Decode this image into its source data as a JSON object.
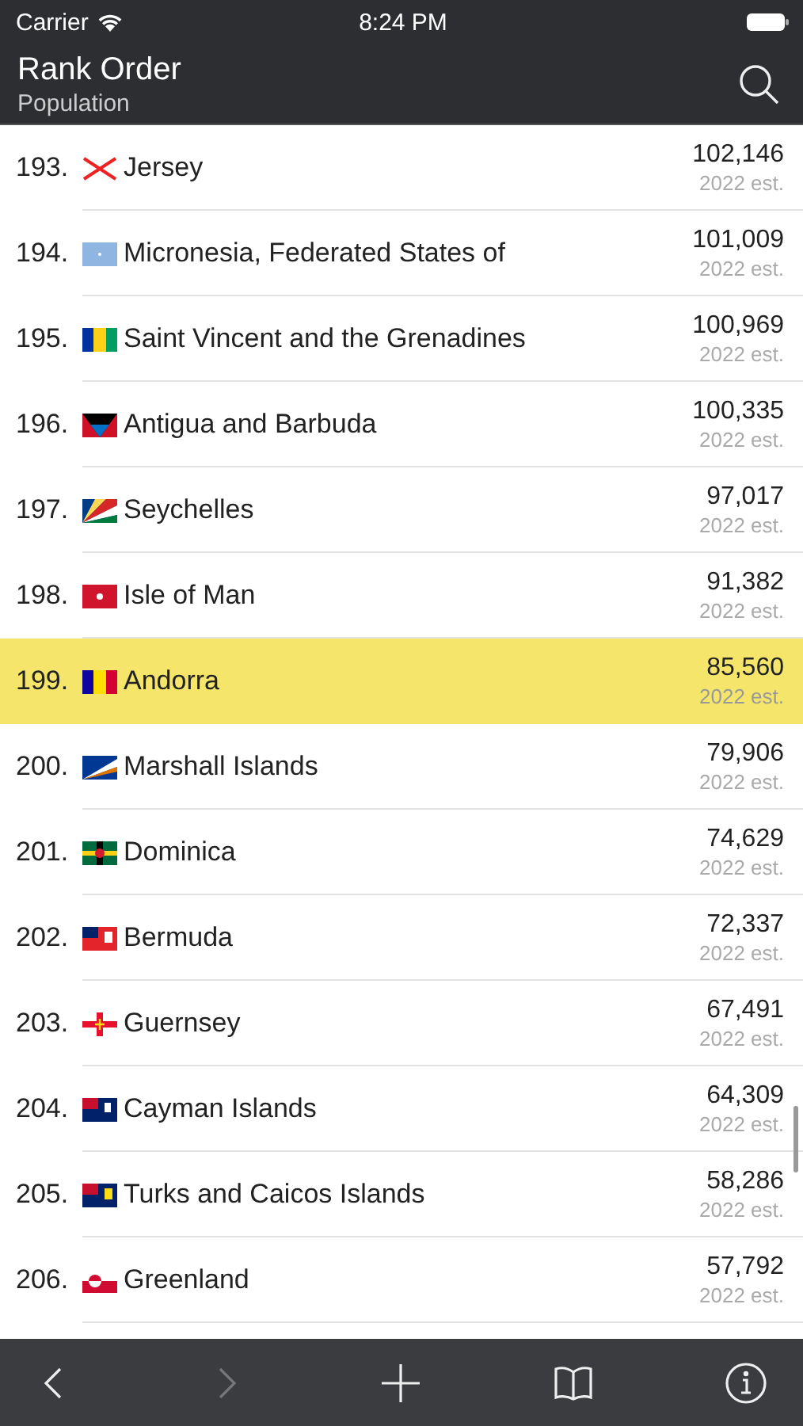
{
  "status_bar": {
    "carrier": "Carrier",
    "time": "8:24 PM"
  },
  "nav_bar": {
    "title": "Rank Order",
    "subtitle": "Population"
  },
  "rows": [
    {
      "rank": "193.",
      "name": "Jersey",
      "value": "102,146",
      "note": "2022 est.",
      "selected": false
    },
    {
      "rank": "194.",
      "name": "Micronesia, Federated States of",
      "value": "101,009",
      "note": "2022 est.",
      "selected": false
    },
    {
      "rank": "195.",
      "name": "Saint Vincent and the Grenadines",
      "value": "100,969",
      "note": "2022 est.",
      "selected": false
    },
    {
      "rank": "196.",
      "name": "Antigua and Barbuda",
      "value": "100,335",
      "note": "2022 est.",
      "selected": false
    },
    {
      "rank": "197.",
      "name": "Seychelles",
      "value": "97,017",
      "note": "2022 est.",
      "selected": false
    },
    {
      "rank": "198.",
      "name": "Isle of Man",
      "value": "91,382",
      "note": "2022 est.",
      "selected": false
    },
    {
      "rank": "199.",
      "name": "Andorra",
      "value": "85,560",
      "note": "2022 est.",
      "selected": true
    },
    {
      "rank": "200.",
      "name": "Marshall Islands",
      "value": "79,906",
      "note": "2022 est.",
      "selected": false
    },
    {
      "rank": "201.",
      "name": "Dominica",
      "value": "74,629",
      "note": "2022 est.",
      "selected": false
    },
    {
      "rank": "202.",
      "name": "Bermuda",
      "value": "72,337",
      "note": "2022 est.",
      "selected": false
    },
    {
      "rank": "203.",
      "name": "Guernsey",
      "value": "67,491",
      "note": "2022 est.",
      "selected": false
    },
    {
      "rank": "204.",
      "name": "Cayman Islands",
      "value": "64,309",
      "note": "2022 est.",
      "selected": false
    },
    {
      "rank": "205.",
      "name": "Turks and Caicos Islands",
      "value": "58,286",
      "note": "2022 est.",
      "selected": false
    },
    {
      "rank": "206.",
      "name": "Greenland",
      "value": "57,792",
      "note": "2022 est.",
      "selected": false
    }
  ],
  "toolbar": [
    {
      "kind": "back",
      "disabled": false
    },
    {
      "kind": "forward",
      "disabled": true
    },
    {
      "kind": "add",
      "disabled": false
    },
    {
      "kind": "bookmarks",
      "disabled": false
    },
    {
      "kind": "info",
      "disabled": false
    }
  ]
}
